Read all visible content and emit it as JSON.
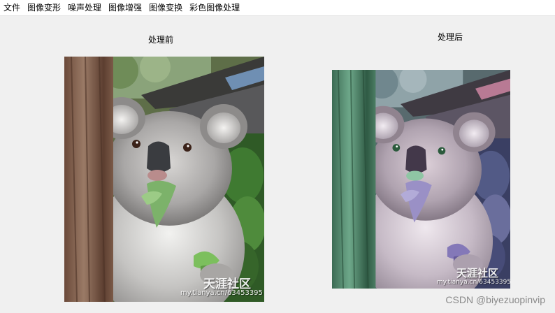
{
  "menu": {
    "items": [
      {
        "label": "文件"
      },
      {
        "label": "图像变形"
      },
      {
        "label": "噪声处理"
      },
      {
        "label": "图像增强"
      },
      {
        "label": "图像变换"
      },
      {
        "label": "彩色图像处理"
      }
    ]
  },
  "panels": {
    "before": {
      "label": "处理前",
      "watermark_site": "天涯社区",
      "watermark_url": "my.tianya.cn/63453395"
    },
    "after": {
      "label": "处理后",
      "watermark_site": "天涯社区",
      "watermark_url": "my.tianya.cn/63453395"
    }
  },
  "footer": {
    "credit": "CSDN @biyezuopinvip"
  },
  "colors": {
    "menubar_bg": "#ffffff",
    "window_bg": "#f0f0f0",
    "credit_text": "#8a8a8a"
  }
}
